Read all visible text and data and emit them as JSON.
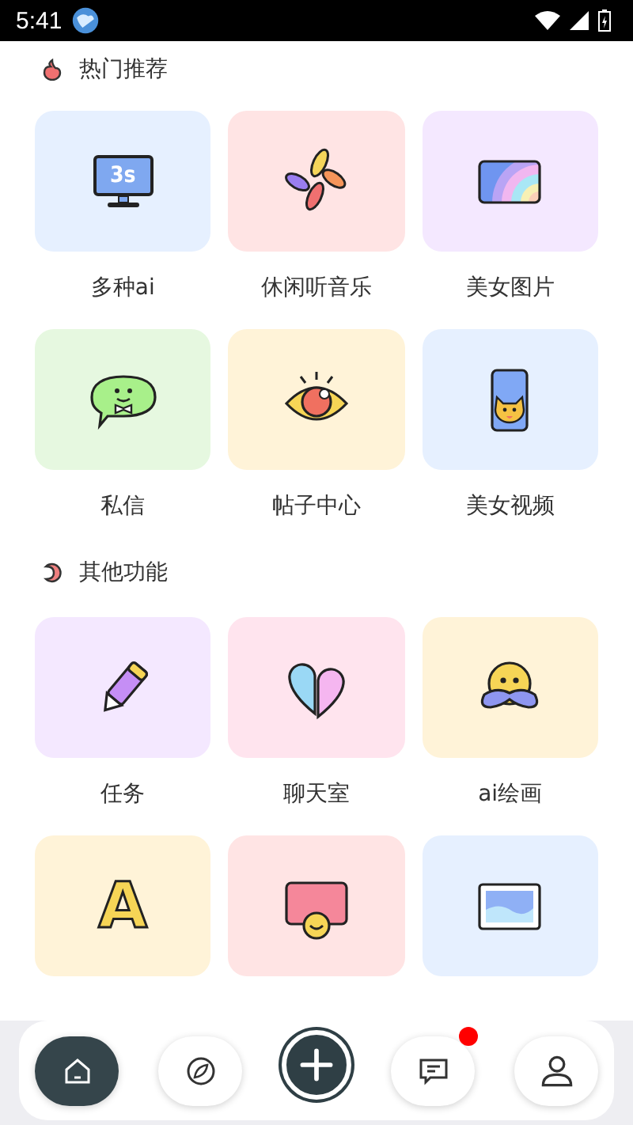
{
  "status_bar": {
    "time": "5:41"
  },
  "sections": [
    {
      "title": "热门推荐",
      "kind": "flame",
      "tiles": [
        {
          "kind": "monitor",
          "glyph": "3s",
          "label": "多种ai",
          "color": "#e6f0ff"
        },
        {
          "kind": "petals",
          "label": "休闲听音乐",
          "color": "#ffe4e4"
        },
        {
          "kind": "rainbow",
          "label": "美女图片",
          "color": "#f4e8ff"
        },
        {
          "kind": "chat",
          "label": "私信",
          "color": "#e6f8e0"
        },
        {
          "kind": "eye",
          "label": "帖子中心",
          "color": "#fff3d8"
        },
        {
          "kind": "phone-cat",
          "label": "美女视频",
          "color": "#e6f0ff"
        }
      ]
    },
    {
      "title": "其他功能",
      "kind": "moon",
      "tiles": [
        {
          "kind": "pencil",
          "label": "任务",
          "color": "#f4e8ff"
        },
        {
          "kind": "hearts",
          "label": "聊天室",
          "color": "#ffe4ee"
        },
        {
          "kind": "mustache",
          "label": "ai绘画",
          "color": "#fff3d8"
        },
        {
          "kind": "letter",
          "glyph": "A",
          "color": "#fff3d8"
        },
        {
          "kind": "card-face",
          "color": "#ffe4e4"
        },
        {
          "kind": "landscape",
          "color": "#e6f0ff"
        }
      ]
    }
  ],
  "nav": [
    {
      "kind": "home",
      "selected": true,
      "badge": false
    },
    {
      "kind": "compass",
      "selected": false,
      "badge": false
    },
    {
      "kind": "add",
      "selected": false,
      "badge": false
    },
    {
      "kind": "message",
      "selected": false,
      "badge": true
    },
    {
      "kind": "user",
      "selected": false,
      "badge": false
    }
  ]
}
